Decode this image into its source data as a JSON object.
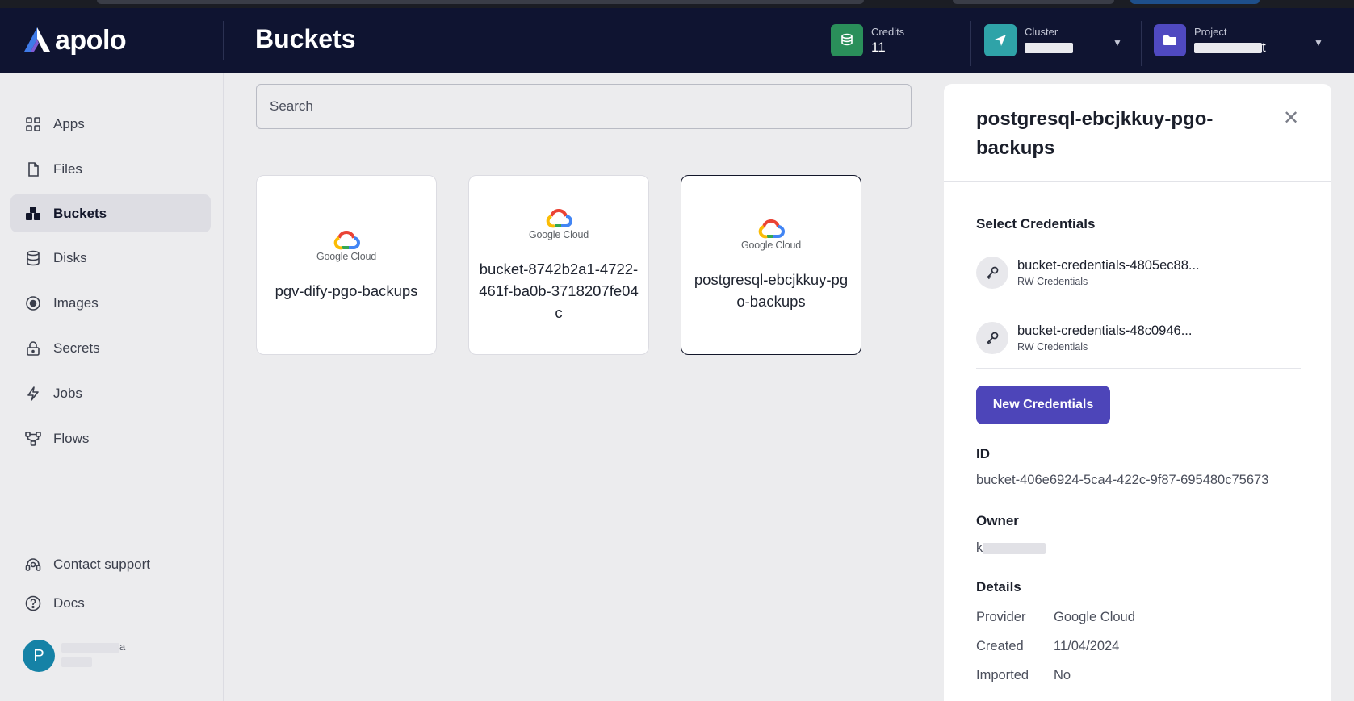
{
  "app": {
    "brand": "apolo",
    "page_title": "Buckets"
  },
  "header": {
    "credits": {
      "label": "Credits",
      "value": "11"
    },
    "cluster": {
      "label": "Cluster"
    },
    "project": {
      "label": "Project",
      "value_suffix": "t"
    }
  },
  "sidebar": {
    "items": [
      {
        "label": "Apps",
        "icon": "apps-grid-icon"
      },
      {
        "label": "Files",
        "icon": "file-icon"
      },
      {
        "label": "Buckets",
        "icon": "buckets-icon",
        "active": true
      },
      {
        "label": "Disks",
        "icon": "database-icon"
      },
      {
        "label": "Images",
        "icon": "image-icon"
      },
      {
        "label": "Secrets",
        "icon": "lock-icon"
      },
      {
        "label": "Jobs",
        "icon": "lightning-icon"
      },
      {
        "label": "Flows",
        "icon": "flow-icon"
      }
    ],
    "footer": [
      {
        "label": "Contact support",
        "icon": "headset-icon"
      },
      {
        "label": "Docs",
        "icon": "help-circle-icon"
      }
    ],
    "user": {
      "initial": "P",
      "name_suffix": "a"
    }
  },
  "search": {
    "placeholder": "Search"
  },
  "buckets": [
    {
      "name": "pgv-dify-pgo-backups",
      "provider_logo_text": "Google Cloud"
    },
    {
      "name": "bucket-8742b2a1-4722-461f-ba0b-3718207fe04c",
      "provider_logo_text": "Google Cloud"
    },
    {
      "name": "postgresql-ebcjkkuy-pgo-backups",
      "provider_logo_text": "Google Cloud",
      "selected": true
    }
  ],
  "detail": {
    "title": "postgresql-ebcjkkuy-pgo-backups",
    "credentials_heading": "Select Credentials",
    "credentials": [
      {
        "name": "bucket-credentials-4805ec88...",
        "type": "RW Credentials"
      },
      {
        "name": "bucket-credentials-48c0946...",
        "type": "RW Credentials"
      }
    ],
    "new_credentials_label": "New Credentials",
    "id_label": "ID",
    "id_value": "bucket-406e6924-5ca4-422c-9f87-695480c75673",
    "owner_label": "Owner",
    "owner_prefix": "k",
    "details_label": "Details",
    "details": [
      {
        "key": "Provider",
        "value": "Google Cloud"
      },
      {
        "key": "Created",
        "value": "11/04/2024"
      },
      {
        "key": "Imported",
        "value": "No"
      }
    ]
  },
  "colors": {
    "topbar": "#0f1431",
    "credits_icon_bg": "#2a8f5a",
    "cluster_icon_bg": "#2fa3a8",
    "project_icon_bg": "#4f49c0",
    "primary_button": "#4d45b9",
    "avatar": "#1582a6"
  }
}
